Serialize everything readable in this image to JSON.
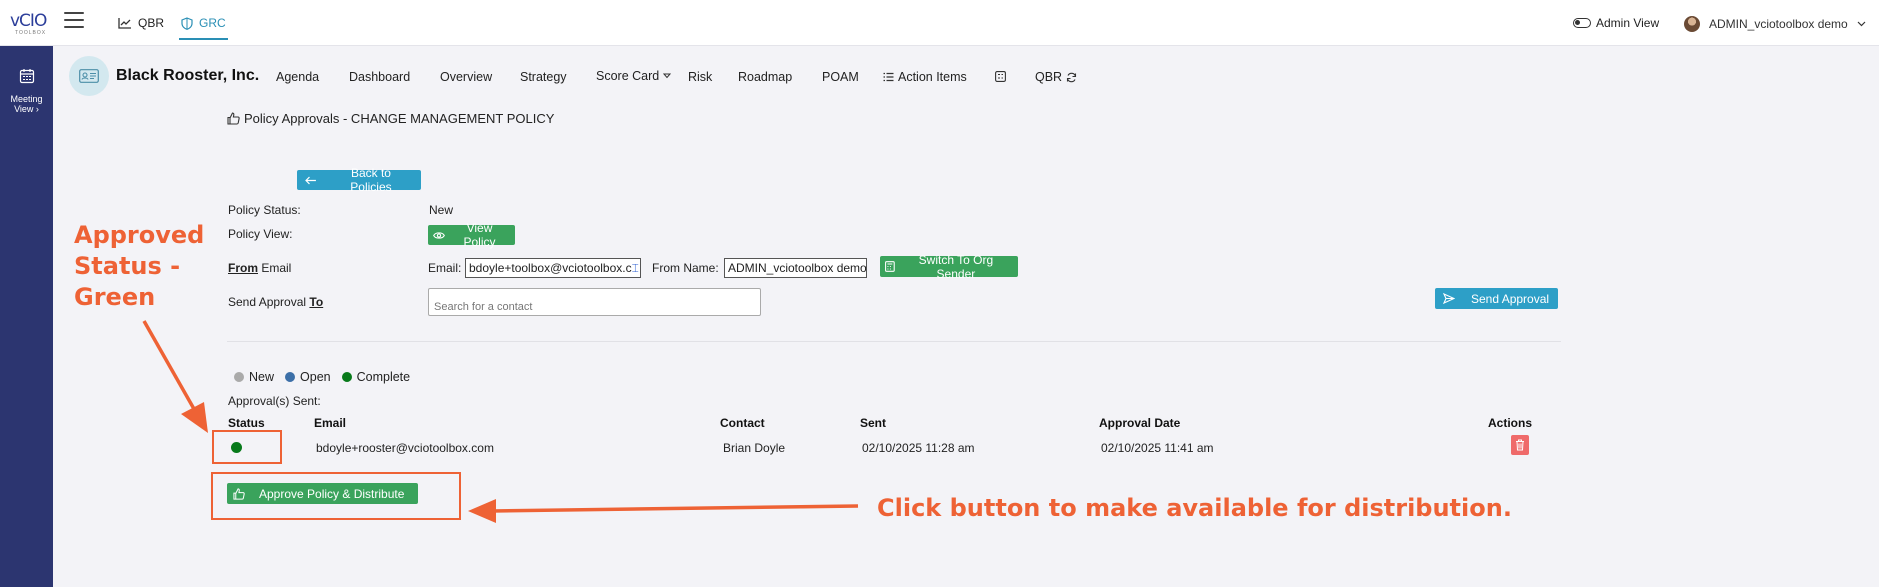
{
  "topbar": {
    "logo_text": "vCIO",
    "logo_sub": "TOOLBOX",
    "tabs": [
      {
        "label": "QBR",
        "icon": "line-chart-icon"
      },
      {
        "label": "GRC",
        "icon": "shield-icon"
      }
    ],
    "admin_view_label": "Admin View",
    "user_name": "ADMIN_vciotoolbox demo"
  },
  "rail": {
    "items": [
      {
        "label_line1": "Meeting",
        "label_line2": "View",
        "icon": "calendar-icon"
      }
    ]
  },
  "company": {
    "name": "Black Rooster, Inc."
  },
  "nav": {
    "agenda": "Agenda",
    "dashboard": "Dashboard",
    "overview": "Overview",
    "strategy": "Strategy",
    "scorecard": "Score Card",
    "risk": "Risk",
    "roadmap": "Roadmap",
    "poam": "POAM",
    "action_items": "Action Items",
    "qbr": "QBR"
  },
  "page": {
    "title": "Policy Approvals - CHANGE MANAGEMENT POLICY"
  },
  "form": {
    "back_button": "Back to Policies",
    "policy_status_label": "Policy Status:",
    "policy_status_value": "New",
    "policy_view_label": "Policy View:",
    "view_policy_button": "View Policy",
    "from_word": "From",
    "email_word": " Email",
    "email_label": "Email:",
    "email_value": "bdoyle+toolbox@vciotoolbox.c",
    "from_name_label": "From Name:",
    "from_name_value": "ADMIN_vciotoolbox demo",
    "switch_button": "Switch To Org Sender",
    "send_approval_label": "Send Approval ",
    "to_word": "To",
    "search_placeholder": "Search for a contact",
    "send_approval_button": "Send Approval"
  },
  "legend": {
    "new": "New",
    "open": "Open",
    "complete": "Complete"
  },
  "approvals": {
    "heading": "Approval(s) Sent:",
    "columns": {
      "status": "Status",
      "email": "Email",
      "contact": "Contact",
      "sent": "Sent",
      "approval_date": "Approval Date",
      "actions": "Actions"
    },
    "rows": [
      {
        "status": "complete",
        "email": "bdoyle+rooster@vciotoolbox.com",
        "contact": "Brian Doyle",
        "sent": "02/10/2025 11:28 am",
        "approval_date": "02/10/2025 11:41 am"
      }
    ],
    "approve_button": "Approve Policy & Distribute"
  },
  "annotations": {
    "status_line1": "Approved",
    "status_line2": "Status -",
    "status_line3": "Green",
    "button_note": "Click button to make available for distribution."
  },
  "colors": {
    "rail": "#2c3570",
    "accent_blue": "#2d9fc7",
    "green": "#3aa35c",
    "annotation": "#ee6235",
    "complete_dot": "#087a1b"
  }
}
